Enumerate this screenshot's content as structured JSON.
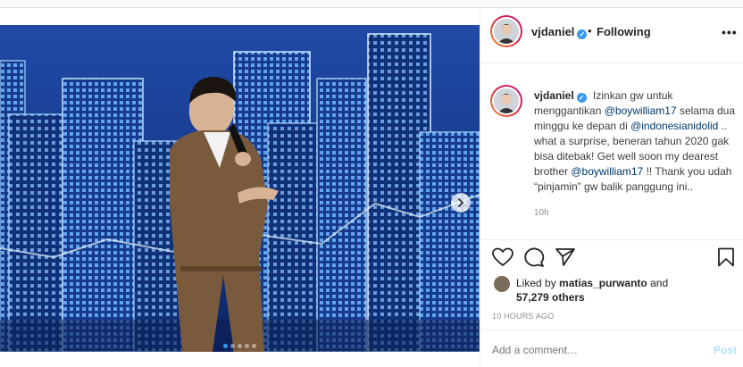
{
  "post": {
    "username": "vjdaniel",
    "verified_symbol": "✓",
    "separator": "•",
    "follow_status": "Following",
    "more_label": "•••",
    "caption": {
      "username": "vjdaniel",
      "segments": [
        {
          "type": "text",
          "value": "Izinkan gw untuk menggantikan "
        },
        {
          "type": "mention",
          "value": "@boywilliam17"
        },
        {
          "type": "text",
          "value": " selama dua minggu ke depan di "
        },
        {
          "type": "mention",
          "value": "@indonesianidolid"
        },
        {
          "type": "text",
          "value": " .. what a surprise, beneran tahun 2020 gak bisa ditebak! Get well soon my dearest brother "
        },
        {
          "type": "mention",
          "value": "@boywilliam17"
        },
        {
          "type": "text",
          "value": " !! Thank you udah “pinjamin” gw balik panggung ini.."
        }
      ],
      "time_ago": "10h"
    },
    "likes": {
      "prefix": "Liked by",
      "first_liker": "matias_purwanto",
      "and": "and",
      "others": "57,279 others"
    },
    "timestamp": "10 HOURS AGO",
    "comment": {
      "placeholder": "Add a comment…",
      "post_label": "Post"
    },
    "carousel": {
      "slide_count": 5,
      "active_index": 0
    },
    "icons": [
      "heart-icon",
      "comment-icon",
      "share-icon",
      "bookmark-icon",
      "chevron-right-icon"
    ],
    "colors": {
      "accent": "#3897f0",
      "mention": "#00376b",
      "post_disabled": "#b2dffc"
    }
  }
}
